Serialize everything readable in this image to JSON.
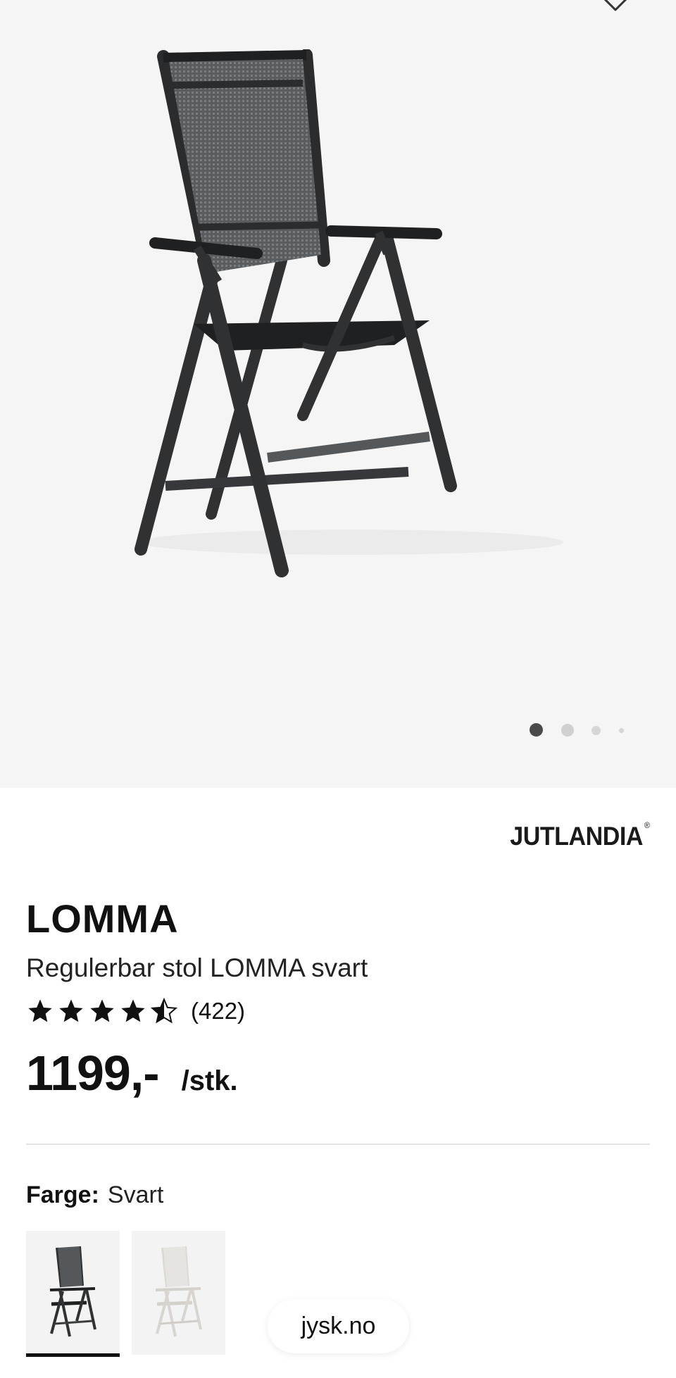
{
  "gallery": {
    "image_alt": "Regulerbar stol LOMMA svart",
    "icons": {
      "favorite": "heart-icon"
    },
    "page_indicator": {
      "count": 4,
      "active": 1
    }
  },
  "brand": {
    "name": "JUTLANDIA",
    "mark": "®"
  },
  "product": {
    "title": "LOMMA",
    "subtitle": "Regulerbar stol LOMMA svart",
    "rating": {
      "value": 4.5,
      "max": 5,
      "count_text": "(422)"
    },
    "price": {
      "amount": "1199,-",
      "unit": "/stk."
    }
  },
  "color": {
    "label": "Farge:",
    "value": "Svart",
    "options": [
      {
        "name": "Svart",
        "selected": true,
        "tone": "#2f3133"
      },
      {
        "name": "Hvit",
        "selected": false,
        "tone": "#e4e2de"
      }
    ]
  },
  "url_pill": {
    "text": "jysk.no"
  }
}
